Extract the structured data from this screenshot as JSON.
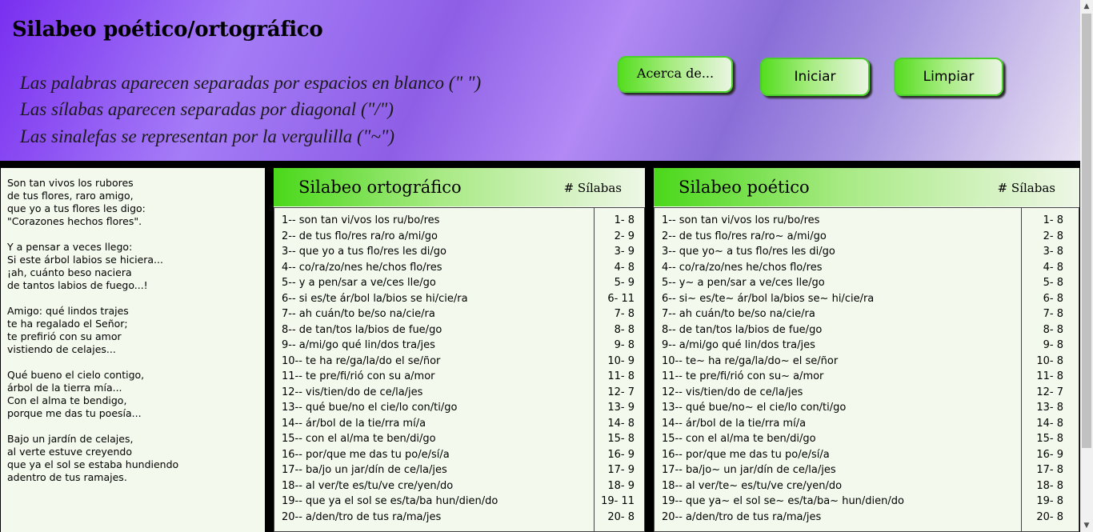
{
  "header": {
    "title": "Silabeo poético/ortográfico",
    "instructions": [
      "Las palabras aparecen separadas por espacios en blanco (\" \")",
      "Las sílabas aparecen separadas por diagonal (\"/\")",
      "Las sinalefas se representan por la vergulilla (\"~\")"
    ],
    "buttons": {
      "about": "Acerca de...",
      "start": "Iniciar",
      "clear": "Limpiar"
    }
  },
  "poem": "Son tan vivos los rubores\nde tus flores, raro amigo,\nque yo a tus flores les digo:\n\"Corazones hechos flores\".\n\nY a pensar a veces llego:\nSi este árbol labios se hiciera...\n¡ah, cuánto beso naciera\nde tantos labios de fuego...!\n\nAmigo: qué lindos trajes\nte ha regalado el Señor;\nte prefirió con su amor\nvistiendo de celajes...\n\nQué bueno el cielo contigo,\nárbol de la tierra mía...\nCon el alma te bendigo,\nporque me das tu poesía...\n\nBajo un jardín de celajes,\nal verte estuve creyendo\nque ya el sol se estaba hundiendo\nadentro de tus ramajes.",
  "orthographic": {
    "title": "Silabeo ortográfico",
    "count_header": "# Sílabas",
    "lines": [
      "1-- son tan vi/vos los ru/bo/res",
      "2-- de tus flo/res ra/ro a/mi/go",
      "3-- que yo a tus flo/res les di/go",
      "4-- co/ra/zo/nes he/chos flo/res",
      "5-- y a pen/sar a ve/ces lle/go",
      "6-- si es/te ár/bol la/bios se hi/cie/ra",
      "7-- ah cuán/to be/so na/cie/ra",
      "8-- de tan/tos la/bios de fue/go",
      "9-- a/mi/go qué lin/dos tra/jes",
      "10-- te ha re/ga/la/do el se/ñor",
      "11-- te pre/fi/rió con su a/mor",
      "12-- vis/tien/do de ce/la/jes",
      "13-- qué bue/no el cie/lo con/ti/go",
      "14-- ár/bol de la tie/rra mí/a",
      "15-- con el al/ma te ben/di/go",
      "16-- por/que me das tu po/e/sí/a",
      "17-- ba/jo un jar/dín de ce/la/jes",
      "18-- al ver/te es/tu/ve cre/yen/do",
      "19-- que ya el sol se es/ta/ba hun/dien/do",
      "20-- a/den/tro de tus ra/ma/jes"
    ],
    "counts": [
      "1- 8",
      "2- 9",
      "3- 9",
      "4- 8",
      "5- 9",
      "6- 11",
      "7- 8",
      "8- 8",
      "9- 8",
      "10- 9",
      "11- 8",
      "12- 7",
      "13- 9",
      "14- 8",
      "15- 8",
      "16- 9",
      "17- 9",
      "18- 9",
      "19- 11",
      "20- 8"
    ]
  },
  "poetic": {
    "title": "Silabeo poético",
    "count_header": "# Sílabas",
    "lines": [
      "1-- son tan vi/vos los ru/bo/res",
      "2-- de tus flo/res ra/ro~ a/mi/go",
      "3-- que yo~ a tus flo/res les di/go",
      "4-- co/ra/zo/nes he/chos flo/res",
      "5-- y~ a pen/sar a ve/ces lle/go",
      "6-- si~ es/te~ ár/bol la/bios se~ hi/cie/ra",
      "7-- ah cuán/to be/so na/cie/ra",
      "8-- de tan/tos la/bios de fue/go",
      "9-- a/mi/go qué lin/dos tra/jes",
      "10-- te~ ha re/ga/la/do~ el se/ñor",
      "11-- te pre/fi/rió con su~ a/mor",
      "12-- vis/tien/do de ce/la/jes",
      "13-- qué bue/no~ el cie/lo con/ti/go",
      "14-- ár/bol de la tie/rra mí/a",
      "15-- con el al/ma te ben/di/go",
      "16-- por/que me das tu po/e/sí/a",
      "17-- ba/jo~ un jar/dín de ce/la/jes",
      "18-- al ver/te~ es/tu/ve cre/yen/do",
      "19-- que ya~ el sol se~ es/ta/ba~ hun/dien/do",
      "20-- a/den/tro de tus ra/ma/jes"
    ],
    "counts": [
      "1- 8",
      "2- 8",
      "3- 8",
      "4- 8",
      "5- 8",
      "6- 8",
      "7- 8",
      "8- 8",
      "9- 8",
      "10- 8",
      "11- 8",
      "12- 7",
      "13- 8",
      "14- 8",
      "15- 8",
      "16- 9",
      "17- 8",
      "18- 8",
      "19- 8",
      "20- 8"
    ]
  },
  "scrollbar": {
    "up_icon": "▲",
    "down_icon": "▼"
  }
}
